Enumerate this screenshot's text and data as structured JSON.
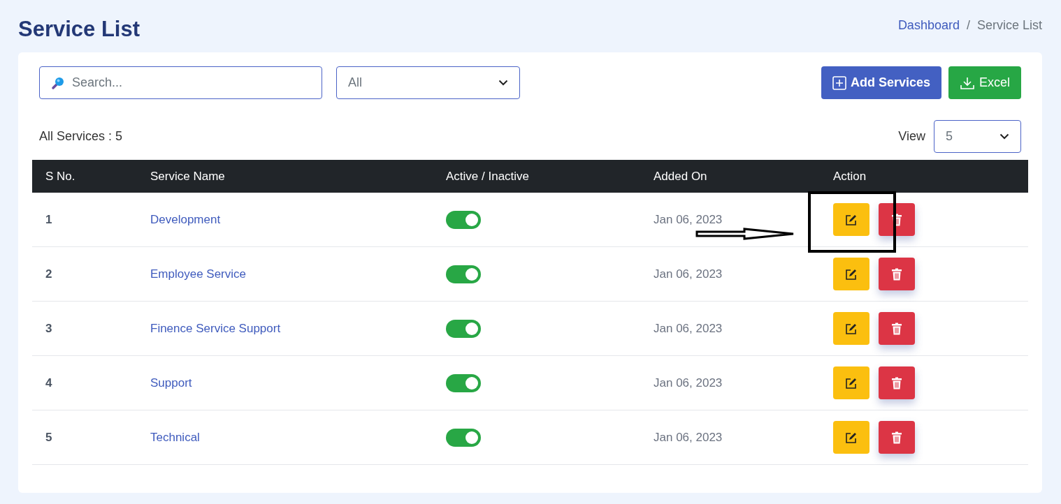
{
  "page_title": "Service List",
  "breadcrumb": [
    {
      "label": "Dashboard",
      "kind": "link"
    },
    {
      "label": "/",
      "kind": "separator"
    },
    {
      "label": "Service List",
      "kind": "current"
    }
  ],
  "search": {
    "placeholder": "Search..."
  },
  "filter": {
    "value": "All"
  },
  "buttons": [
    {
      "label": "Add Services",
      "kind": "add"
    },
    {
      "label": "Excel",
      "kind": "excel"
    }
  ],
  "count_label": "All Services : 5",
  "view": {
    "label": "View",
    "value": "5"
  },
  "table": {
    "columns": [
      "S No.",
      "Service Name",
      "Active / Inactive",
      "Added On",
      "Action"
    ],
    "rows": [
      {
        "sno": "1",
        "name": "Development",
        "active": true,
        "added_on": "Jan 06, 2023",
        "highlighted": true
      },
      {
        "sno": "2",
        "name": "Employee Service",
        "active": true,
        "added_on": "Jan 06, 2023",
        "highlighted": false
      },
      {
        "sno": "3",
        "name": "Finence Service Support",
        "active": true,
        "added_on": "Jan 06, 2023",
        "highlighted": false
      },
      {
        "sno": "4",
        "name": "Support",
        "active": true,
        "added_on": "Jan 06, 2023",
        "highlighted": false
      },
      {
        "sno": "5",
        "name": "Technical",
        "active": true,
        "added_on": "Jan 06, 2023",
        "highlighted": false
      }
    ]
  }
}
